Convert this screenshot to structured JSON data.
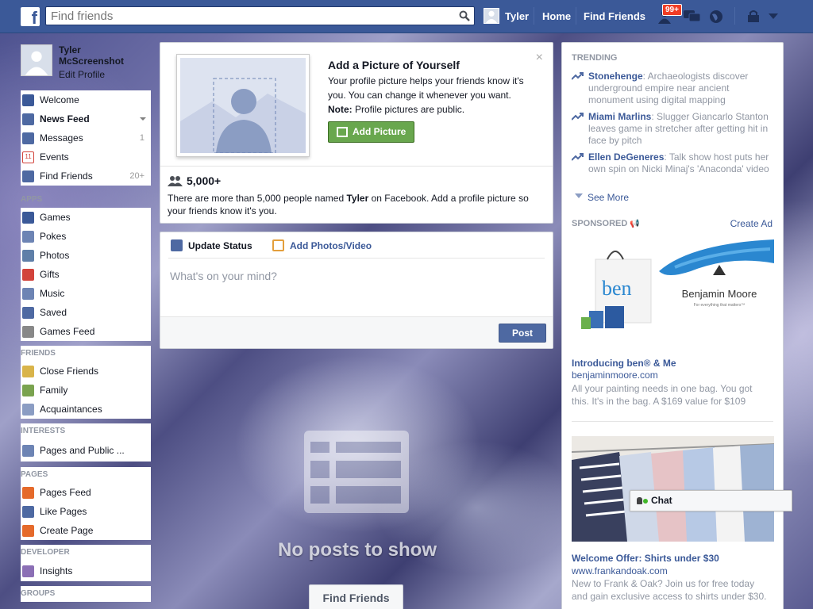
{
  "topbar": {
    "logo": "f",
    "search_placeholder": "Find friends",
    "user_name": "Tyler",
    "home_label": "Home",
    "find_friends_label": "Find Friends",
    "notification_count": "99+"
  },
  "sidebar": {
    "profile_name": "Tyler McScreenshot",
    "edit_profile": "Edit Profile",
    "main_items": [
      {
        "label": "Welcome",
        "icon": "facebook-icon",
        "color": "#3b5998"
      },
      {
        "label": "News Feed",
        "icon": "news-feed-icon",
        "color": "#4e69a2"
      },
      {
        "label": "Messages",
        "icon": "messages-icon",
        "count": "1",
        "color": "#4e69a2"
      },
      {
        "label": "Events",
        "icon": "calendar-icon",
        "color": "#d2433b"
      },
      {
        "label": "Find Friends",
        "icon": "friends-icon",
        "count": "20+",
        "color": "#4e69a2"
      }
    ],
    "apps_header": "APPS",
    "apps": [
      {
        "label": "Games",
        "icon": "games-icon",
        "color": "#3b5998"
      },
      {
        "label": "Pokes",
        "icon": "pokes-icon",
        "color": "#6d84b4"
      },
      {
        "label": "Photos",
        "icon": "photos-icon",
        "color": "#5f7fa8"
      },
      {
        "label": "Gifts",
        "icon": "gift-icon",
        "color": "#d2433b"
      },
      {
        "label": "Music",
        "icon": "music-icon",
        "color": "#6d84b4"
      },
      {
        "label": "Saved",
        "icon": "bookmark-icon",
        "color": "#4e69a2"
      },
      {
        "label": "Games Feed",
        "icon": "gamepad-icon",
        "color": "#888"
      }
    ],
    "friends_header": "FRIENDS",
    "friends": [
      {
        "label": "Close Friends",
        "icon": "star-icon",
        "color": "#d9b44a"
      },
      {
        "label": "Family",
        "icon": "home-icon",
        "color": "#7aa34f"
      },
      {
        "label": "Acquaintances",
        "icon": "list-icon",
        "color": "#8b9dc3"
      }
    ],
    "interests_header": "INTERESTS",
    "interests": [
      {
        "label": "Pages and Public ...",
        "icon": "rss-icon",
        "color": "#6d84b4"
      }
    ],
    "pages_header": "PAGES",
    "pages": [
      {
        "label": "Pages Feed",
        "icon": "megaphone-icon",
        "color": "#e56a2b"
      },
      {
        "label": "Like Pages",
        "icon": "thumbs-up-icon",
        "color": "#4e69a2"
      },
      {
        "label": "Create Page",
        "icon": "plus-icon",
        "color": "#e56a2b"
      }
    ],
    "developer_header": "DEVELOPER",
    "developer": [
      {
        "label": "Insights",
        "icon": "chart-icon",
        "color": "#8b6fb5"
      }
    ],
    "groups_header": "GROUPS"
  },
  "profile_prompt": {
    "title": "Add a Picture of Yourself",
    "body": "Your profile picture helps your friends know it's you. You can change it whenever you want.",
    "note_label": "Note:",
    "note_text": " Profile pictures are public.",
    "button": "Add Picture",
    "close": "×",
    "people_count": "5,000+",
    "people_text_1": "There are more than 5,000 people named ",
    "people_name": "Tyler",
    "people_text_2": " on Facebook. Add a profile picture so your friends know it's you."
  },
  "composer": {
    "tab_status": "Update Status",
    "tab_photos": "Add Photos/Video",
    "placeholder": "What's on your mind?",
    "post_button": "Post"
  },
  "feed": {
    "empty_text": "No posts to show",
    "find_friends_button": "Find Friends"
  },
  "right": {
    "trending_header": "TRENDING",
    "trends": [
      {
        "topic": "Stonehenge",
        "text": ": Archaeologists discover underground empire near ancient monument using digital mapping"
      },
      {
        "topic": "Miami Marlins",
        "text": ": Slugger Giancarlo Stanton leaves game in stretcher after getting hit in face by pitch"
      },
      {
        "topic": "Ellen DeGeneres",
        "text": ": Talk show host puts her own spin on Nicki Minaj's 'Anaconda' video"
      }
    ],
    "see_more": "See More",
    "sponsored_header": "SPONSORED",
    "create_ad": "Create Ad",
    "ads": [
      {
        "brand_in_image": "Benjamin Moore",
        "brand_tagline": "For everything that matters™",
        "bag_text": "ben",
        "title": "Introducing ben® & Me",
        "url": "benjaminmoore.com",
        "desc": "All your painting needs in one bag. You got this. It's in the bag. A $169 value for $109"
      },
      {
        "title": "Welcome Offer: Shirts under $30",
        "url": "www.frankandoak.com",
        "desc": "New to Frank & Oak? Join us for free today and gain exclusive access to shirts under $30."
      }
    ]
  },
  "chat": {
    "label": "Chat"
  }
}
